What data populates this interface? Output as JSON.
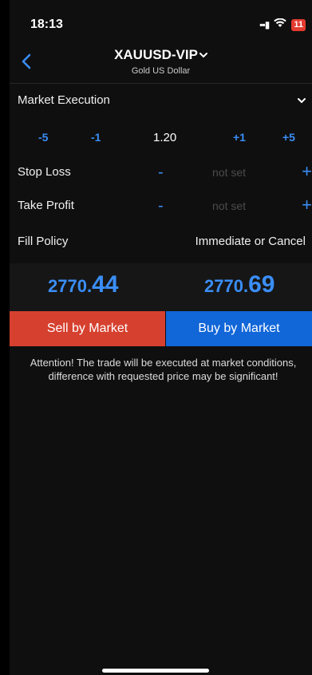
{
  "status_bar": {
    "time": "18:13",
    "battery": "11",
    "icons": [
      "signal-icon",
      "wifi-icon",
      "battery-icon"
    ]
  },
  "header": {
    "symbol": "XAUUSD-VIP",
    "description": "Gold US Dollar",
    "icons": [
      "back-chevron-icon",
      "chevron-down-icon"
    ]
  },
  "order": {
    "execution_type": "Market Execution",
    "volume": {
      "minus5": "-5",
      "minus1": "-1",
      "value": "1.20",
      "plus1": "+1",
      "plus5": "+5"
    },
    "stop_loss": {
      "label": "Stop Loss",
      "minus": "-",
      "value": "not set",
      "plus": "+"
    },
    "take_profit": {
      "label": "Take Profit",
      "minus": "-",
      "value": "not set",
      "plus": "+"
    },
    "fill_policy": {
      "label": "Fill Policy",
      "value": "Immediate or Cancel"
    }
  },
  "prices": {
    "bid_main": "2770.",
    "bid_pips": "44",
    "ask_main": "2770.",
    "ask_pips": "69"
  },
  "actions": {
    "sell_label": "Sell by Market",
    "buy_label": "Buy by Market"
  },
  "attention_text": "Attention! The trade will be executed at market conditions, difference with requested price may be significant!",
  "colors": {
    "accent": "#3a8ef6",
    "sell": "#d6402f",
    "buy": "#1166d8",
    "battery": "#e43b2f"
  }
}
